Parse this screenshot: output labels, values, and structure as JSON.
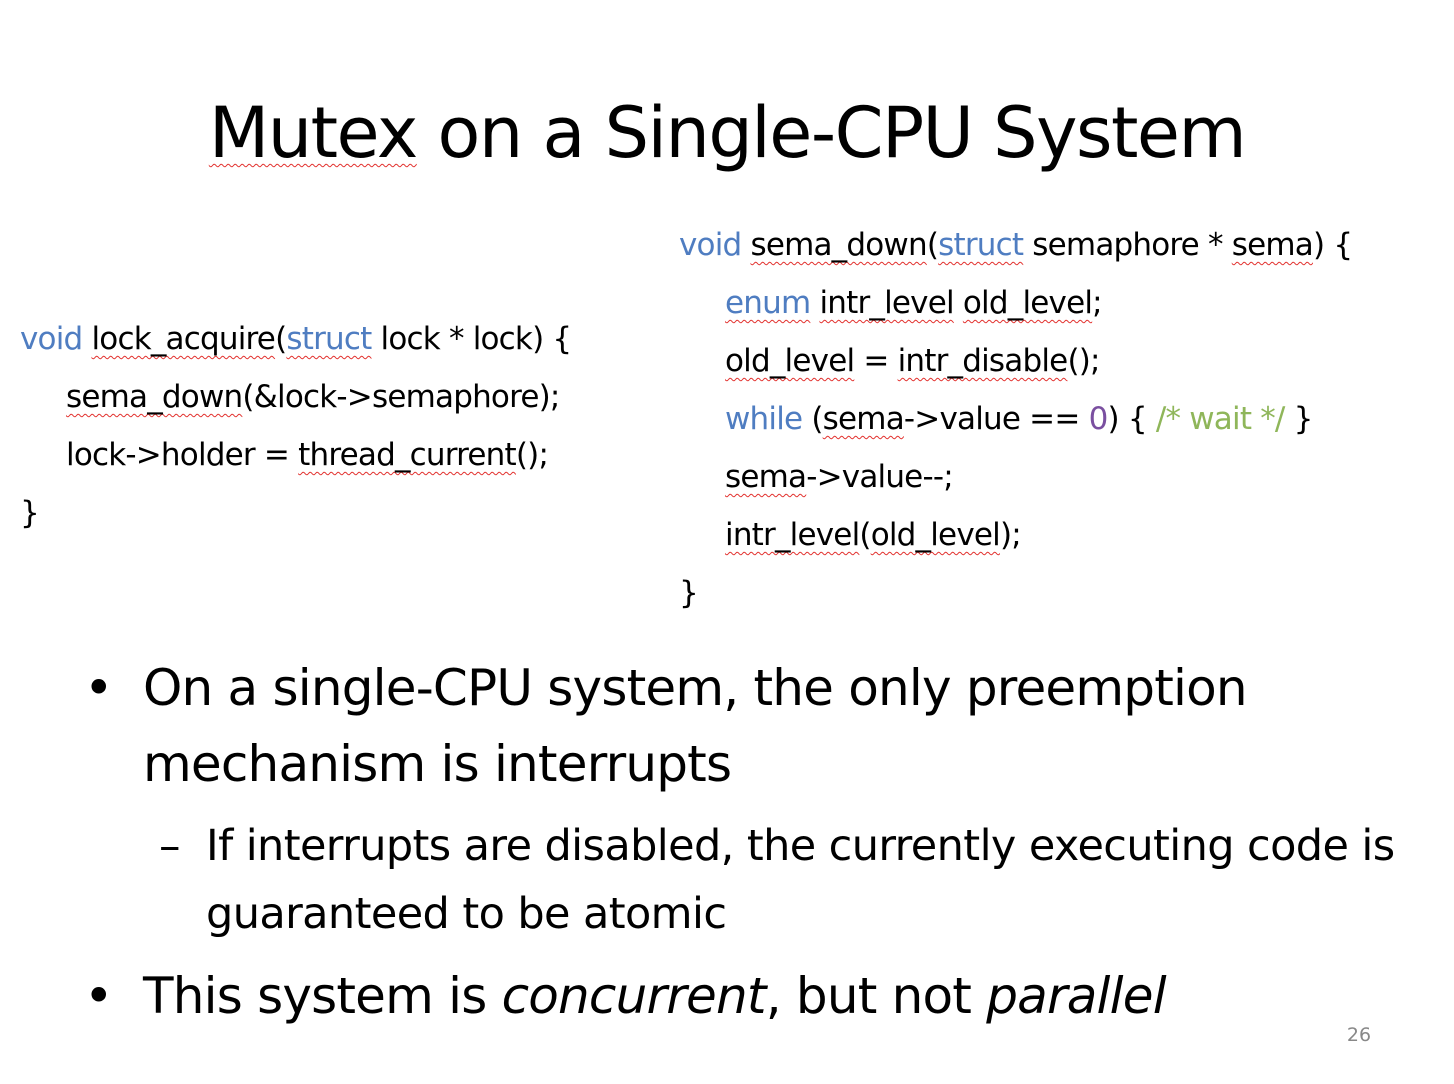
{
  "slide": {
    "title": "Mutex on a Single-CPU System",
    "page_number": "26"
  },
  "code_left": {
    "line1": {
      "kw_void": "void",
      "fn": "lock_acquire",
      "open": "(",
      "kw_struct": "struct",
      "rest": " lock * lock) {"
    },
    "line2": {
      "fn": "sema_down",
      "rest": "(&lock->semaphore);"
    },
    "line3": {
      "pre": "lock->holder = ",
      "fn": "thread_current",
      "rest": "();"
    },
    "line4": {
      "text": "}"
    }
  },
  "code_right": {
    "line1": {
      "kw_void": "void",
      "fn": "sema_down",
      "open": "(",
      "kw_struct": "struct",
      "mid": " semaphore * ",
      "arg": "sema",
      "rest": ") {"
    },
    "line2": {
      "kw_enum": "enum",
      "type": "intr_level",
      "var": "old_level",
      "rest": ";"
    },
    "line3": {
      "var": "old_level",
      "mid": " = ",
      "fn": "intr_disable",
      "rest": "();"
    },
    "line4": {
      "kw_while": "while",
      "pre": " (",
      "var": "sema",
      "mid": "->value == ",
      "num": "0",
      "post": ") { ",
      "comment": "/* wait */",
      "end": " }"
    },
    "line5": {
      "var": "sema",
      "rest": "->value--;"
    },
    "line6": {
      "fn": "intr_level",
      "open": "(",
      "var": "old_level",
      "rest": ");"
    },
    "line7": {
      "text": "}"
    }
  },
  "bullets": {
    "marker": "•",
    "sub_marker": "–",
    "b1_text": "On a single-CPU system, the only preemption mechanism is interrupts",
    "b1_sub_text": "If interrupts are disabled, the currently executing code is guaranteed to be atomic",
    "b2_pre": "This system is ",
    "b2_em1": "concurrent",
    "b2_mid": ", but not ",
    "b2_em2": "parallel"
  },
  "colors": {
    "keyword": "#4f7dc1",
    "number": "#7a4fa0",
    "comment": "#8fb65a",
    "spellcheck_squiggle": "#e2302d",
    "page_number": "#888888"
  }
}
